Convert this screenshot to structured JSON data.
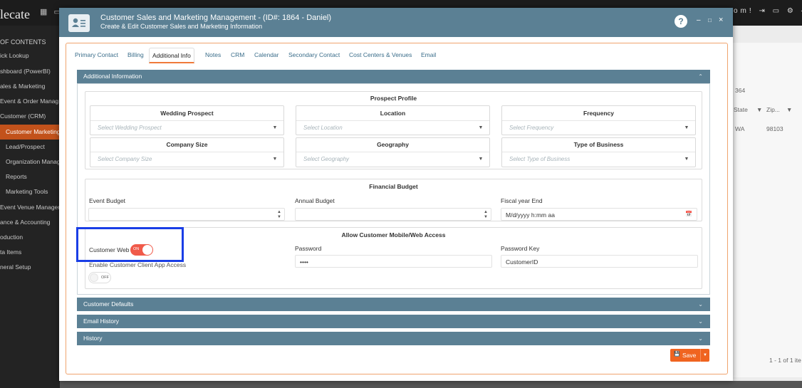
{
  "background": {
    "logo": "lecate",
    "logo_icons": "▦ ▭",
    "topbar_right": "om! ⇥ ▭ ⚙ ◀ ◐",
    "toc_header": "OF CONTENTS",
    "sidebar_items": [
      {
        "label": "ick Lookup"
      },
      {
        "label": "shboard (PowerBI)"
      },
      {
        "label": "ales & Marketing"
      },
      {
        "label": "Event & Order Manag..."
      },
      {
        "label": "Customer (CRM)"
      },
      {
        "label": "Customer Marketing",
        "active": true
      },
      {
        "label": "Lead/Prospect"
      },
      {
        "label": "Organization Manag"
      },
      {
        "label": "Reports"
      },
      {
        "label": "Marketing Tools"
      },
      {
        "label": "Event Venue Managem"
      },
      {
        "label": "ance & Accounting"
      },
      {
        "label": "oduction"
      },
      {
        "label": "ta Items"
      },
      {
        "label": "neral Setup"
      }
    ],
    "grid_id": "364",
    "col_state": "State",
    "col_zip": "Zip...",
    "row_state": "WA",
    "row_zip": "98103",
    "pager": "1 - 1 of 1 ite"
  },
  "modal": {
    "title": "Customer Sales and Marketing Management - (ID#: 1864 - Daniel)",
    "subtitle": "Create & Edit Customer Sales and Marketing Information",
    "help": "?",
    "minimize": "–",
    "maximize": "□",
    "close": "×"
  },
  "tabs": [
    {
      "label": "Primary Contact"
    },
    {
      "label": "Billing"
    },
    {
      "label": "Additional Info",
      "active": true
    },
    {
      "label": "Notes"
    },
    {
      "label": "CRM"
    },
    {
      "label": "Calendar"
    },
    {
      "label": "Secondary Contact"
    },
    {
      "label": "Cost Centers & Venues"
    },
    {
      "label": "Email"
    }
  ],
  "additional_info": {
    "header": "Additional Information",
    "prospect_profile": {
      "title": "Prospect Profile",
      "fields": [
        {
          "label": "Wedding Prospect",
          "placeholder": "Select Wedding Prospect"
        },
        {
          "label": "Location",
          "placeholder": "Select Location"
        },
        {
          "label": "Frequency",
          "placeholder": "Select Frequency"
        },
        {
          "label": "Company Size",
          "placeholder": "Select Company Size"
        },
        {
          "label": "Geography",
          "placeholder": "Select Geography"
        },
        {
          "label": "Type of Business",
          "placeholder": "Select Type of Business"
        }
      ]
    },
    "financial_budget": {
      "title": "Financial Budget",
      "event_budget_label": "Event Budget",
      "event_budget_value": "",
      "annual_budget_label": "Annual Budget",
      "annual_budget_value": "",
      "fiscal_year_end_label": "Fiscal year End",
      "fiscal_year_end_value": "M/d/yyyy h:mm aa"
    },
    "access": {
      "title": "Allow Customer Mobile/Web Access",
      "customer_web_label": "Customer Web",
      "customer_web_toggle": "ON",
      "client_app_label": "Enable Customer Client App Access",
      "client_app_toggle": "OFF",
      "password_label": "Password",
      "password_value": "••••",
      "password_key_label": "Password Key",
      "password_key_value": "CustomerID"
    }
  },
  "sections": [
    {
      "label": "Customer Defaults"
    },
    {
      "label": "Email History"
    },
    {
      "label": "History"
    }
  ],
  "icons": {
    "collapse": "⌃",
    "expand": "⌄",
    "dropdown": "▼",
    "spin_up": "▲",
    "spin_down": "▼",
    "calendar": "📅",
    "save": "💾",
    "save_dropdown": "▼",
    "filter": "▼"
  },
  "save_label": "Save",
  "colors": {
    "header": "#5b8094",
    "accent": "#f06420",
    "toggle_on": "#f05a4a",
    "highlight": "#1a3ee6"
  }
}
